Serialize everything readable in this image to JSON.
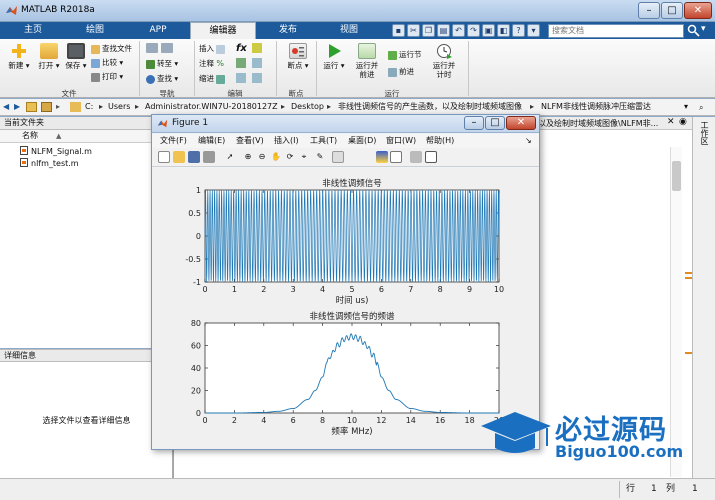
{
  "window": {
    "title": "MATLAB R2018a",
    "minimize": "–",
    "maximize": "□",
    "close": "✕"
  },
  "tabs": [
    "主页",
    "绘图",
    "APP",
    "编辑器",
    "发布",
    "视图"
  ],
  "search_placeholder": "搜索文档",
  "ribbon": {
    "new": "新建",
    "open": "打开",
    "save": "保存",
    "find_files": "查找文件",
    "compare": "比较",
    "print": "打印",
    "insert": "插入",
    "comment": "注释",
    "indent": "缩进",
    "goto": "转至",
    "find": "查找",
    "breakpoint": "断点",
    "run": "运行",
    "run_advance_1": "运行并",
    "run_advance_2": "前进",
    "run_section": "运行节",
    "advance": "前进",
    "run_time_1": "运行并",
    "run_time_2": "计时",
    "groups": {
      "file": "文件",
      "nav": "导航",
      "edit": "编辑",
      "breakpoints": "断点",
      "run": "运行"
    },
    "fx": "fx"
  },
  "address": {
    "drive": "C:",
    "crumbs": [
      "Users",
      "Administrator.WIN7U-20180127Z",
      "Desktop",
      "非线性调频信号的产生函数，以及绘制时域频域图像",
      "NLFM非线性调频脉冲压缩雷达"
    ],
    "editor_path": "以及绘制时域频域图像\\NLFM非..."
  },
  "current_folder": {
    "title": "当前文件夹",
    "col_name": "名称",
    "sort_arrow": "▲",
    "files": [
      "NLFM_Signal.m",
      "nlfm_test.m"
    ]
  },
  "details": {
    "title": "详细信息",
    "message": "选择文件以查看详细信息"
  },
  "workspace_label": "工作区",
  "status": {
    "row_label": "行",
    "row": "1",
    "col_label": "列",
    "col": "1"
  },
  "figure": {
    "title": "Figure 1",
    "menu": [
      "文件(F)",
      "编辑(E)",
      "查看(V)",
      "插入(I)",
      "工具(T)",
      "桌面(D)",
      "窗口(W)",
      "帮助(H)"
    ],
    "toolbar_icons": [
      "new-figure-icon",
      "open-icon",
      "save-icon",
      "print-icon",
      "pointer-icon",
      "zoom-in-icon",
      "zoom-out-icon",
      "pan-icon",
      "rotate-icon",
      "datacursor-icon",
      "brush-icon",
      "link-icon",
      "colorbar-icon",
      "legend-icon",
      "hide-tools-icon",
      "dock-icon"
    ]
  },
  "chart_data": [
    {
      "type": "line",
      "title": "非线性调频信号",
      "xlabel": "时间 us)",
      "ylabel": "",
      "xlim": [
        0,
        10
      ],
      "ylim": [
        -1,
        1
      ],
      "xticks": [
        0,
        1,
        2,
        3,
        4,
        5,
        6,
        7,
        8,
        9,
        10
      ],
      "yticks": [
        -1,
        -0.5,
        0,
        0.5,
        1
      ],
      "series": [
        {
          "description": "cos(phase(t)) oscillating between -1 and 1, ~95 cycles over 0–10 us",
          "color": "#1f77b4"
        }
      ]
    },
    {
      "type": "line",
      "title": "非线性调频信号的频谱",
      "xlabel": "频率 MHz)",
      "ylabel": "",
      "xlim": [
        0,
        20
      ],
      "ylim": [
        0,
        80
      ],
      "xticks": [
        0,
        2,
        4,
        6,
        8,
        10,
        12,
        14,
        16,
        18,
        20
      ],
      "yticks": [
        0,
        20,
        40,
        60,
        80
      ],
      "x": [
        0,
        2,
        4,
        5,
        6,
        7,
        7.5,
        8,
        8.3,
        8.6,
        9,
        9.5,
        10,
        10.5,
        11,
        11.4,
        11.7,
        12,
        12.5,
        13,
        14,
        15,
        16,
        18,
        20
      ],
      "y": [
        0,
        0,
        0.5,
        1.5,
        4,
        12,
        20,
        32,
        45,
        52,
        60,
        66,
        68,
        66,
        60,
        52,
        45,
        32,
        20,
        12,
        4,
        1.5,
        0.5,
        0,
        0
      ],
      "color": "#1f77b4"
    }
  ],
  "watermark": {
    "title": "必过源码",
    "url": "Biguo100.com"
  }
}
